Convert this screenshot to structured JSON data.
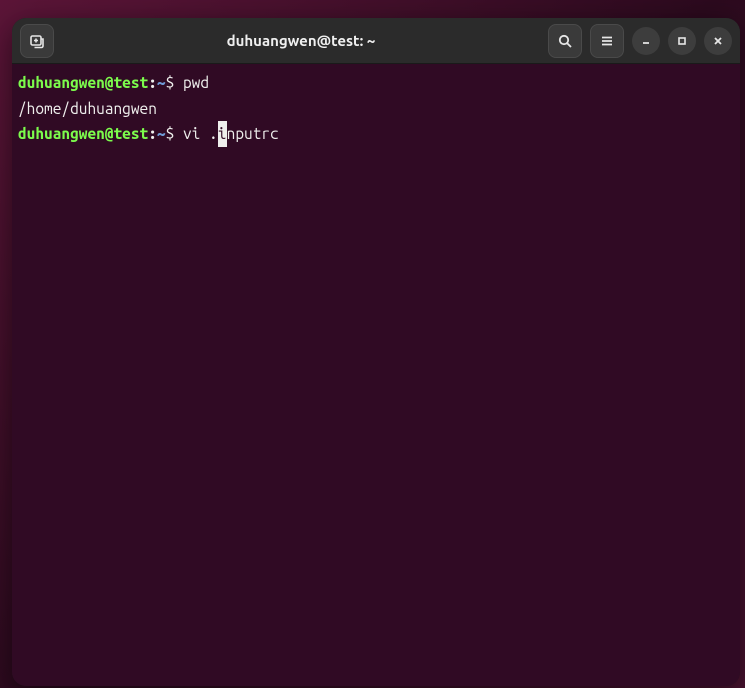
{
  "window": {
    "title": "duhuangwen@test: ~"
  },
  "terminal": {
    "lines": [
      {
        "prompt_user": "duhuangwen@test",
        "prompt_colon": ":",
        "prompt_path": "~",
        "prompt_dollar": "$",
        "command": "pwd"
      }
    ],
    "output1": "/home/duhuangwen",
    "current": {
      "prompt_user": "duhuangwen@test",
      "prompt_colon": ":",
      "prompt_path": "~",
      "prompt_dollar": "$",
      "cmd_before": "vi .",
      "cursor_char": "i",
      "cmd_after": "nputrc"
    }
  },
  "icons": {
    "new_tab": "new-tab",
    "search": "search",
    "menu": "menu",
    "minimize": "minimize",
    "maximize": "maximize",
    "close": "close"
  }
}
